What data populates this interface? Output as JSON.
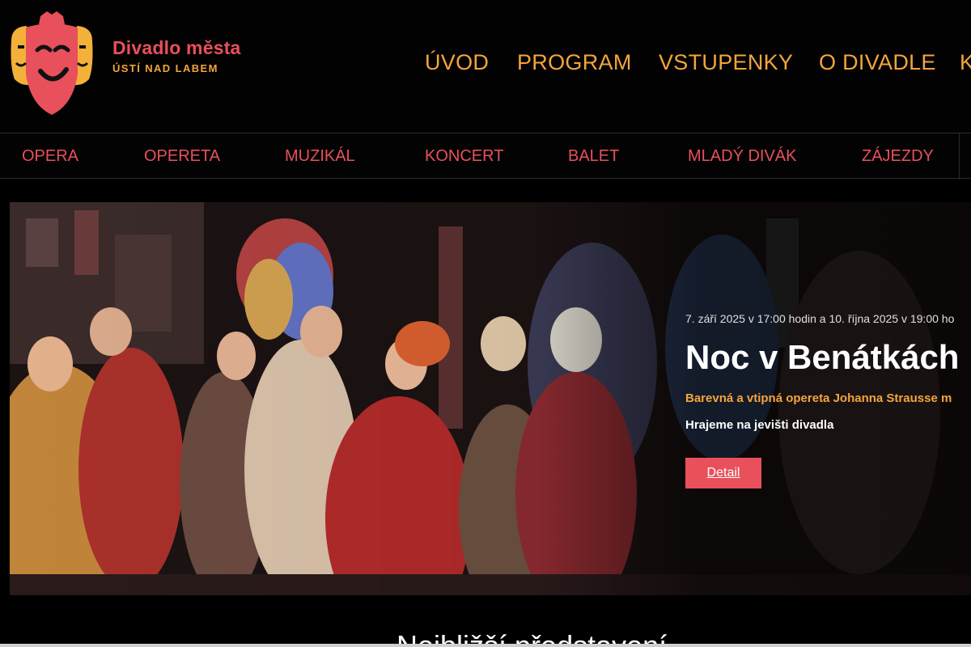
{
  "brand": {
    "title": "Divadlo města",
    "subtitle": "ÚSTÍ NAD LABEM",
    "logo_icon": "theatre-mask-logo-icon",
    "colors": {
      "primary": "#e8505b",
      "accent": "#f3a53c"
    }
  },
  "main_nav": {
    "items": [
      {
        "label": "ÚVOD"
      },
      {
        "label": "PROGRAM"
      },
      {
        "label": "VSTUPENKY"
      },
      {
        "label": "O DIVADLE"
      },
      {
        "label": "K"
      }
    ]
  },
  "categories": {
    "items": [
      {
        "label": "OPERA"
      },
      {
        "label": "OPERETA"
      },
      {
        "label": "MUZIKÁL"
      },
      {
        "label": "KONCERT"
      },
      {
        "label": "BALET"
      },
      {
        "label": "MLADÝ DIVÁK"
      },
      {
        "label": "ZÁJEZDY"
      }
    ]
  },
  "hero": {
    "date": "7. září 2025 v 17:00 hodin a 10. října 2025 v 19:00 ho",
    "title": "Noc v Benátkách",
    "description": "Barevná a vtipná opereta Johanna Strausse m",
    "venue": "Hrajeme na jevišti divadla",
    "button_label": "Detail"
  },
  "next_section": {
    "heading": "Nejbližší představení"
  }
}
